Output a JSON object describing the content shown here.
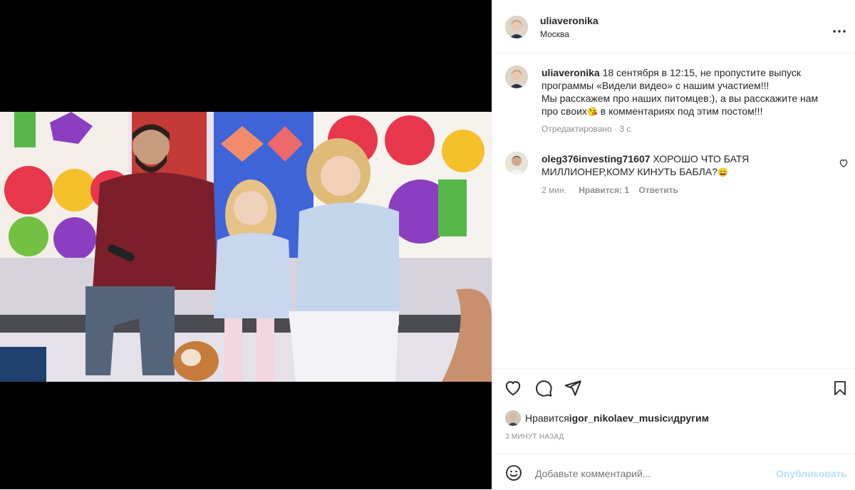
{
  "post": {
    "author": "uliaveronika",
    "location": "Москва",
    "more_icon": "more-horizontal-icon"
  },
  "caption": {
    "author": "uliaveronika",
    "line1": " 18 сентября в 12:15, не пропустите выпуск",
    "line2": "программы «Видели видео» с нашим участием!!!",
    "line3": "Мы расскажем про наших питомцев:), а вы расскажите нам",
    "line4a": "про своих",
    "line4b": " в комментариях под этим постом!!!",
    "emoji": "😘",
    "meta": "Отредактировано · 3 с"
  },
  "comment": {
    "author": "oleg376investing71607",
    "line1": " ХОРОШО ЧТО БАТЯ",
    "line2": "МИЛЛИОНЕР,КОМУ КИНУТЬ БАБЛА?",
    "emoji": "😄",
    "time": "2 мин.",
    "likes": "Нравится: 1",
    "reply": "Ответить"
  },
  "actions": {
    "liked_prefix": "Нравится ",
    "liked_user": "igor_nikolaev_music",
    "liked_and": " и ",
    "liked_others": "другим",
    "timestamp": "3 МИНУТ НАЗАД"
  },
  "composer": {
    "placeholder": "Добавьте комментарий...",
    "publish": "Опубликовать"
  },
  "colors": {
    "text": "#262626",
    "muted": "#8e8e8e",
    "link_disabled": "#b2dffc",
    "border": "#efefef"
  }
}
